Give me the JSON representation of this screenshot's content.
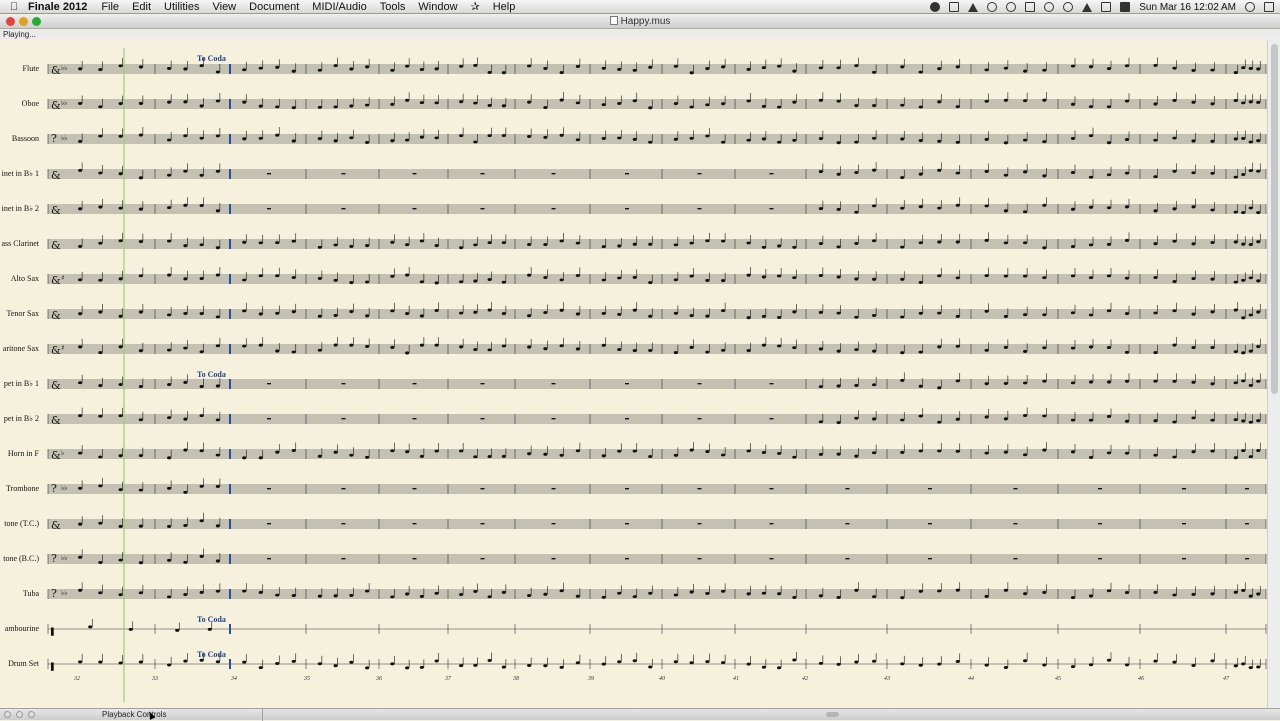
{
  "menubar": {
    "apple_icon": "apple-logo",
    "app_name": "Finale 2012",
    "items": [
      "File",
      "Edit",
      "Utilities",
      "View",
      "Document",
      "MIDI/Audio",
      "Tools",
      "Window",
      "✰",
      "Help"
    ],
    "clock": "Sun Mar 16  12:02 AM"
  },
  "window": {
    "title": "Happy.mus"
  },
  "status": {
    "text": "Playing..."
  },
  "score": {
    "staves": [
      {
        "name": "Flute",
        "clef": "treble",
        "key": "Bb"
      },
      {
        "name": "Oboe",
        "clef": "treble",
        "key": "Bb"
      },
      {
        "name": "Bassoon",
        "clef": "bass",
        "key": "Bb"
      },
      {
        "name": "inet in B♭ 1",
        "clef": "treble",
        "key": "C"
      },
      {
        "name": "inet in B♭ 2",
        "clef": "treble",
        "key": "C"
      },
      {
        "name": "ass Clarinet",
        "clef": "treble",
        "key": "C"
      },
      {
        "name": "Alto Sax",
        "clef": "treble",
        "key": "G"
      },
      {
        "name": "Tenor Sax",
        "clef": "treble",
        "key": "C"
      },
      {
        "name": "aritone Sax",
        "clef": "treble",
        "key": "G"
      },
      {
        "name": "pet in B♭ 1",
        "clef": "treble",
        "key": "C"
      },
      {
        "name": "pet in B♭ 2",
        "clef": "treble",
        "key": "C"
      },
      {
        "name": "Horn in F",
        "clef": "treble",
        "key": "F"
      },
      {
        "name": "Trombone",
        "clef": "bass",
        "key": "Bb"
      },
      {
        "name": "tone (T.C.)",
        "clef": "treble",
        "key": "C"
      },
      {
        "name": "tone (B.C.)",
        "clef": "bass",
        "key": "Bb"
      },
      {
        "name": "Tuba",
        "clef": "bass",
        "key": "Bb"
      },
      {
        "name": "ambourine",
        "clef": "percussion",
        "key": "none"
      },
      {
        "name": "Drum Set",
        "clef": "percussion",
        "key": "none"
      }
    ],
    "coda_text": "To Coda",
    "measure_numbers": [
      "32",
      "33",
      "34",
      "35",
      "36",
      "37",
      "38",
      "39",
      "40",
      "41",
      "42",
      "43",
      "44",
      "45",
      "46",
      "47"
    ]
  },
  "playback": {
    "panel_title": "Playback Controls"
  },
  "colors": {
    "paper": "#f5f1dd",
    "ink": "#111111",
    "coda": "#1c3f8f",
    "playback_cursor": "#a8c878",
    "drum_accent": "#c0392b"
  }
}
